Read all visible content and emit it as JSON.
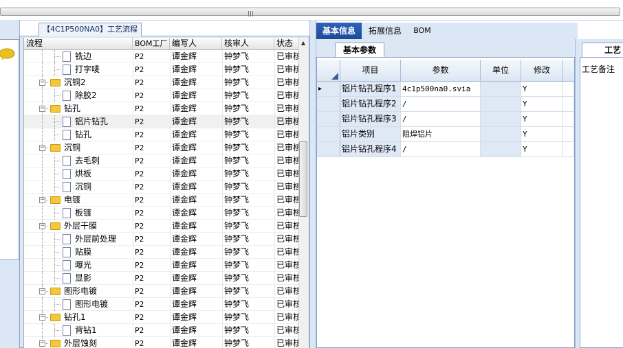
{
  "top_strip": {},
  "process_panel": {
    "tab_title": "【4C1P500NA0】工艺流程",
    "columns": [
      "流程",
      "BOM工厂",
      "编写人",
      "核审人",
      "状态"
    ],
    "rows": [
      {
        "level": 2,
        "kind": "doc",
        "name": "铣边",
        "bom": "P2",
        "writer": "谭金辉",
        "reviewer": "钟梦飞",
        "status": "已审核"
      },
      {
        "level": 2,
        "kind": "doc",
        "name": "打字唛",
        "bom": "P2",
        "writer": "谭金辉",
        "reviewer": "钟梦飞",
        "status": "已审核"
      },
      {
        "level": 1,
        "kind": "folder",
        "name": "沉铜2",
        "bom": "P2",
        "writer": "谭金辉",
        "reviewer": "钟梦飞",
        "status": "已审核"
      },
      {
        "level": 2,
        "kind": "doc",
        "name": "除胶2",
        "bom": "P2",
        "writer": "谭金辉",
        "reviewer": "钟梦飞",
        "status": "已审核"
      },
      {
        "level": 1,
        "kind": "folder",
        "name": "钻孔",
        "bom": "P2",
        "writer": "谭金辉",
        "reviewer": "钟梦飞",
        "status": "已审核"
      },
      {
        "level": 2,
        "kind": "doc",
        "name": "铝片钻孔",
        "bom": "P2",
        "writer": "谭金辉",
        "reviewer": "钟梦飞",
        "status": "已审核",
        "selected": true
      },
      {
        "level": 2,
        "kind": "doc",
        "name": "钻孔",
        "bom": "P2",
        "writer": "谭金辉",
        "reviewer": "钟梦飞",
        "status": "已审核"
      },
      {
        "level": 1,
        "kind": "folder",
        "name": "沉铜",
        "bom": "P2",
        "writer": "谭金辉",
        "reviewer": "钟梦飞",
        "status": "已审核"
      },
      {
        "level": 2,
        "kind": "doc",
        "name": "去毛刺",
        "bom": "P2",
        "writer": "谭金辉",
        "reviewer": "钟梦飞",
        "status": "已审核"
      },
      {
        "level": 2,
        "kind": "doc",
        "name": "烘板",
        "bom": "P2",
        "writer": "谭金辉",
        "reviewer": "钟梦飞",
        "status": "已审核"
      },
      {
        "level": 2,
        "kind": "doc",
        "name": "沉铜",
        "bom": "P2",
        "writer": "谭金辉",
        "reviewer": "钟梦飞",
        "status": "已审核"
      },
      {
        "level": 1,
        "kind": "folder",
        "name": "电镀",
        "bom": "P2",
        "writer": "谭金辉",
        "reviewer": "钟梦飞",
        "status": "已审核"
      },
      {
        "level": 2,
        "kind": "doc",
        "name": "板镀",
        "bom": "P2",
        "writer": "谭金辉",
        "reviewer": "钟梦飞",
        "status": "已审核"
      },
      {
        "level": 1,
        "kind": "folder",
        "name": "外层干膜",
        "bom": "P2",
        "writer": "谭金辉",
        "reviewer": "钟梦飞",
        "status": "已审核"
      },
      {
        "level": 2,
        "kind": "doc",
        "name": "外层前处理",
        "bom": "P2",
        "writer": "谭金辉",
        "reviewer": "钟梦飞",
        "status": "已审核"
      },
      {
        "level": 2,
        "kind": "doc",
        "name": "贴膜",
        "bom": "P2",
        "writer": "谭金辉",
        "reviewer": "钟梦飞",
        "status": "已审核"
      },
      {
        "level": 2,
        "kind": "doc",
        "name": "曝光",
        "bom": "P2",
        "writer": "谭金辉",
        "reviewer": "钟梦飞",
        "status": "已审核"
      },
      {
        "level": 2,
        "kind": "doc",
        "name": "显影",
        "bom": "P2",
        "writer": "谭金辉",
        "reviewer": "钟梦飞",
        "status": "已审核"
      },
      {
        "level": 1,
        "kind": "folder",
        "name": "图形电镀",
        "bom": "P2",
        "writer": "谭金辉",
        "reviewer": "钟梦飞",
        "status": "已审核"
      },
      {
        "level": 2,
        "kind": "doc",
        "name": "图形电镀",
        "bom": "P2",
        "writer": "谭金辉",
        "reviewer": "钟梦飞",
        "status": "已审核"
      },
      {
        "level": 1,
        "kind": "folder",
        "name": "钻孔1",
        "bom": "P2",
        "writer": "谭金辉",
        "reviewer": "钟梦飞",
        "status": "已审核"
      },
      {
        "level": 2,
        "kind": "doc",
        "name": "背钻1",
        "bom": "P2",
        "writer": "谭金辉",
        "reviewer": "钟梦飞",
        "status": "已审核"
      },
      {
        "level": 1,
        "kind": "folder",
        "name": "外层蚀刻",
        "bom": "P2",
        "writer": "谭金辉",
        "reviewer": "钟梦飞",
        "status": "已审核"
      }
    ]
  },
  "detail_tabs": {
    "tabs": [
      "基本信息",
      "拓展信息",
      "BOM"
    ],
    "active": "基本信息"
  },
  "basic_params": {
    "tab_title": "基本参数",
    "columns": [
      "项目",
      "参数",
      "单位",
      "修改"
    ],
    "rows": [
      {
        "item": "铝片钻孔程序1",
        "param": "4c1p500na0.svia",
        "unit": "",
        "modify": "Y",
        "current": true
      },
      {
        "item": "铝片钻孔程序2",
        "param": "/",
        "unit": "",
        "modify": "Y"
      },
      {
        "item": "铝片钻孔程序3",
        "param": "/",
        "unit": "",
        "modify": "Y"
      },
      {
        "item": "铝片类别",
        "param": "阻焊铝片",
        "unit": "",
        "modify": "Y"
      },
      {
        "item": "铝片钻孔程序4",
        "param": "/",
        "unit": "",
        "modify": "Y"
      }
    ]
  },
  "notes_panel": {
    "tab_title": "工艺",
    "label": "工艺备注"
  }
}
